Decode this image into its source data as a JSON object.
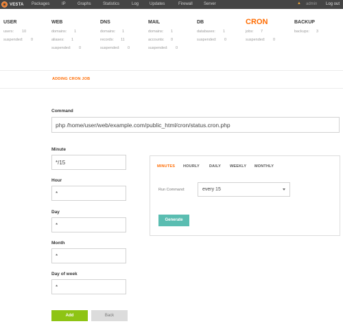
{
  "nav": {
    "logo_text": "VESTA",
    "items": [
      "Packages",
      "IP",
      "Graphs",
      "Statistics",
      "Log",
      "Updates",
      "Firewall",
      "Server"
    ],
    "user": "admin",
    "logout": "Log out"
  },
  "panels": [
    {
      "title": "USER",
      "rows": [
        "users:",
        "10",
        "suspended:",
        "0"
      ]
    },
    {
      "title": "WEB",
      "rows": [
        "domains:",
        "1",
        "aliases:",
        "1",
        "suspended:",
        "0"
      ]
    },
    {
      "title": "DNS",
      "rows": [
        "domains:",
        "1",
        "records:",
        "11",
        "suspended:",
        "0"
      ]
    },
    {
      "title": "MAIL",
      "rows": [
        "domains:",
        "1",
        "accounts:",
        "0",
        "suspended:",
        "0"
      ]
    },
    {
      "title": "DB",
      "rows": [
        "databases:",
        "1",
        "suspended:",
        "0"
      ]
    },
    {
      "title": "CRON",
      "rows": [
        "jobs:",
        "7",
        "suspended:",
        "0"
      ]
    },
    {
      "title": "BACKUP",
      "rows": [
        "backups:",
        "3"
      ]
    }
  ],
  "section": {
    "title": "ADDING CRON JOB"
  },
  "form": {
    "command_label": "Command",
    "command_value": "php /home/user/web/example.com/public_html/cron/status.cron.php",
    "minute_label": "Minute",
    "minute_value": "*/15",
    "hour_label": "Hour",
    "hour_value": "*",
    "day_label": "Day",
    "day_value": "*",
    "month_label": "Month",
    "month_value": "*",
    "dow_label": "Day of week",
    "dow_value": "*"
  },
  "generator": {
    "tabs": [
      "MINUTES",
      "HOURLY",
      "DAILY",
      "WEEKLY",
      "MONTHLY"
    ],
    "active_tab": "MINUTES",
    "run_label": "Run Command:",
    "run_value": "every 15",
    "generate_label": "Generate"
  },
  "buttons": {
    "add": "Add",
    "back": "Back"
  },
  "colors": {
    "accent": "#ff6b00",
    "add_button": "#8ec414",
    "generate_button": "#5abdb1",
    "topbar": "#444444"
  },
  "icons": {
    "logo": "vesta-logo-icon",
    "notification": "bell-icon",
    "select_caret": "chevron-down-icon"
  }
}
